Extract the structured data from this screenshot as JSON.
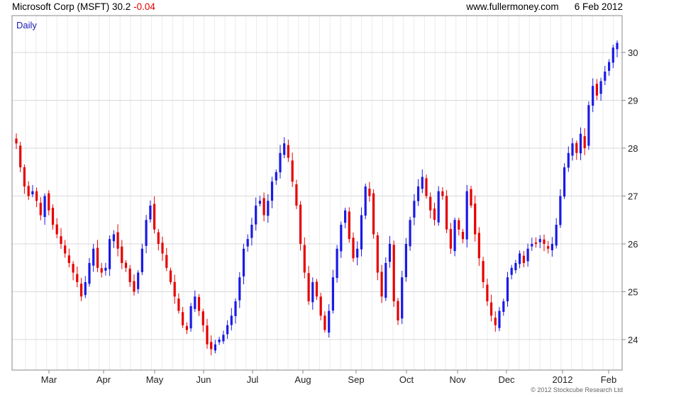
{
  "header": {
    "title": "Microsoft Corp (MSFT)",
    "last_price": "30.2",
    "change": "-0.04",
    "site": "www.fullermoney.com",
    "date": "6 Feb 2012"
  },
  "copyright": "© 2012 Stockcube Research Ltd",
  "colors": {
    "up": "#1a1ae6",
    "down": "#e60000",
    "grid": "#dddddd",
    "frame": "#888888",
    "label": "#1a1ab4"
  },
  "chart_data": {
    "type": "candlestick",
    "period_label": "Daily",
    "y_ticks": [
      24,
      25,
      26,
      27,
      28,
      29,
      30
    ],
    "ylim": [
      23.33,
      30.76
    ],
    "x_labels": [
      "Mar",
      "Apr",
      "May",
      "Jun",
      "Jul",
      "Aug",
      "Sep",
      "Oct",
      "Nov",
      "Dec",
      "2012",
      "Feb"
    ],
    "series": [
      {
        "values": [
          28.1,
          27.6,
          27.2,
          27.0,
          27.1,
          26.9,
          26.6,
          27.0,
          26.7,
          26.4,
          26.2,
          26.0,
          25.8,
          25.6,
          25.4,
          25.2,
          24.9,
          25.2,
          25.6,
          25.9,
          25.5,
          25.4,
          25.5,
          26.1,
          26.2,
          25.9,
          25.6,
          25.5,
          25.2,
          25.0,
          25.4,
          25.9,
          26.5,
          26.8,
          26.3,
          26.0,
          25.8,
          25.5,
          25.2,
          24.9,
          24.6,
          24.3,
          24.2,
          24.7,
          24.9,
          24.6,
          24.3,
          23.9,
          23.8,
          23.9,
          24.0,
          24.1,
          24.3,
          24.5,
          24.8,
          25.3,
          25.9,
          26.1,
          26.4,
          26.8,
          26.9,
          26.6,
          26.9,
          27.3,
          27.5,
          27.9,
          28.1,
          27.8,
          27.3,
          26.8,
          26.0,
          25.4,
          24.8,
          25.2,
          24.9,
          24.5,
          24.2,
          24.6,
          25.3,
          25.9,
          26.4,
          26.7,
          26.1,
          25.7,
          25.9,
          26.6,
          27.2,
          27.0,
          26.2,
          25.4,
          24.9,
          25.6,
          26.0,
          24.8,
          24.4,
          25.3,
          26.0,
          26.5,
          26.9,
          27.2,
          27.4,
          27.0,
          26.7,
          26.5,
          27.1,
          27.0,
          26.3,
          25.9,
          26.5,
          26.3,
          26.1,
          27.1,
          26.8,
          26.2,
          25.7,
          25.2,
          24.8,
          24.5,
          24.3,
          24.6,
          24.8,
          25.3,
          25.5,
          25.6,
          25.8,
          25.6,
          25.9,
          26.0,
          26.0,
          26.1,
          26.0,
          25.9,
          26.0,
          26.4,
          27.0,
          27.6,
          27.9,
          28.1,
          27.9,
          28.3,
          28.0,
          28.9,
          29.3,
          29.1,
          29.4,
          29.6,
          29.8,
          30.1,
          30.2
        ]
      }
    ]
  }
}
